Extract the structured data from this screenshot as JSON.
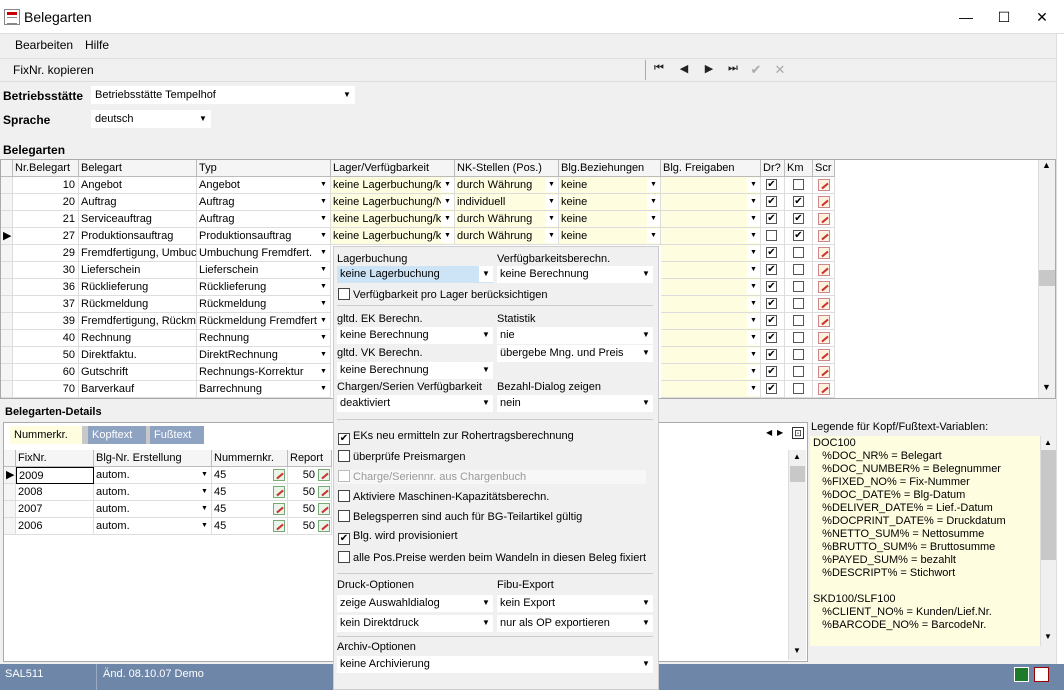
{
  "window": {
    "title": "Belegarten"
  },
  "menu": {
    "edit": "Bearbeiten",
    "help": "Hilfe"
  },
  "toolbar": {
    "copy_fixnr": "FixNr. kopieren"
  },
  "filters": {
    "betriebsstaette_label": "Betriebsstätte",
    "betriebsstaette_value": "Betriebsstätte Tempelhof",
    "sprache_label": "Sprache",
    "sprache_value": "deutsch"
  },
  "belegarten": {
    "section_title": "Belegarten",
    "columns": [
      "Nr.Belegart",
      "Belegart",
      "Typ",
      "Lager/Verfügbarkeit",
      "NK-Stellen (Pos.)",
      "Blg.Beziehungen",
      "Blg. Freigaben",
      "Dr?",
      "Km",
      "Scr"
    ],
    "rows": [
      {
        "nr": "10",
        "name": "Angebot",
        "typ": "Angebot",
        "lager": "keine Lagerbuchung/k",
        "nk": "durch Währung",
        "bez": "keine",
        "dr": true,
        "km": false
      },
      {
        "nr": "20",
        "name": "Auftrag",
        "typ": "Auftrag",
        "lager": "keine Lagerbuchung/N",
        "nk": "individuell",
        "bez": "keine",
        "dr": true,
        "km": true
      },
      {
        "nr": "21",
        "name": "Serviceauftrag",
        "typ": "Auftrag",
        "lager": "keine Lagerbuchung/k",
        "nk": "durch Währung",
        "bez": "keine",
        "dr": true,
        "km": true
      },
      {
        "nr": "27",
        "name": "Produktionsauftrag",
        "typ": "Produktionsauftrag",
        "lager": "keine Lagerbuchung/k",
        "nk": "durch Währung",
        "bez": "keine",
        "dr": false,
        "km": true
      },
      {
        "nr": "29",
        "name": "Fremdfertigung, Umbuch",
        "typ": "Umbuchung Fremdfert.",
        "dr": true,
        "km": false
      },
      {
        "nr": "30",
        "name": "Lieferschein",
        "typ": "Lieferschein",
        "dr": true,
        "km": false
      },
      {
        "nr": "36",
        "name": "Rücklieferung",
        "typ": "Rücklieferung",
        "dr": true,
        "km": false
      },
      {
        "nr": "37",
        "name": "Rückmeldung",
        "typ": "Rückmeldung",
        "dr": true,
        "km": false
      },
      {
        "nr": "39",
        "name": "Fremdfertigung, Rückme",
        "typ": "Rückmeldung Fremdfert",
        "dr": true,
        "km": false
      },
      {
        "nr": "40",
        "name": "Rechnung",
        "typ": "Rechnung",
        "dr": true,
        "km": false
      },
      {
        "nr": "50",
        "name": "Direktfaktu.",
        "typ": "DirektRechnung",
        "dr": true,
        "km": false
      },
      {
        "nr": "60",
        "name": "Gutschrift",
        "typ": "Rechnungs-Korrektur",
        "dr": true,
        "km": false
      },
      {
        "nr": "70",
        "name": "Barverkauf",
        "typ": "Barrechnung",
        "dr": true,
        "km": false
      }
    ]
  },
  "popup": {
    "lagerbuchung_label": "Lagerbuchung",
    "lagerbuchung_value": "keine Lagerbuchung",
    "verf_label": "Verfügbarkeitsberechn.",
    "verf_value": "keine Berechnung",
    "verf_pro_lager": "Verfügbarkeit pro Lager berücksichtigen",
    "ek_label": "gltd. EK Berechn.",
    "ek_value": "keine Berechnung",
    "statistik_label": "Statistik",
    "statistik_value": "nie",
    "vk_label": "gltd. VK Berechn.",
    "vk_value": "keine Berechnung",
    "uebergabe_value": "übergebe Mng. und Preis",
    "chargen_label": "Chargen/Serien Verfügbarkeit",
    "chargen_value": "deaktiviert",
    "bezahl_label": "Bezahl-Dialog zeigen",
    "bezahl_value": "nein",
    "checks": [
      {
        "label": "EKs neu ermitteln zur Rohertragsberechnung",
        "checked": true
      },
      {
        "label": "überprüfe Preismargen",
        "checked": false
      },
      {
        "label": "Charge/Seriennr. aus Chargenbuch",
        "checked": false
      },
      {
        "label": "Aktiviere Maschinen-Kapazitätsberechn.",
        "checked": false
      },
      {
        "label": "Belegsperren sind auch für BG-Teilartikel gültig",
        "checked": false
      },
      {
        "label": "Blg. wird provisioniert",
        "checked": true
      },
      {
        "label": "alle Pos.Preise werden beim Wandeln in diesen Beleg fixiert",
        "checked": false
      }
    ],
    "druck_label": "Druck-Optionen",
    "druck_value": "zeige Auswahldialog",
    "direktdruck_value": "kein Direktdruck",
    "fibu_label": "Fibu-Export",
    "fibu_value": "kein Export",
    "op_value": "nur als OP exportieren",
    "archiv_label": "Archiv-Optionen",
    "archiv_value": "keine Archivierung"
  },
  "details": {
    "section_title": "Belegarten-Details",
    "tabs": [
      "Nummerkr.",
      "Kopftext",
      "Fußtext"
    ],
    "columns": [
      "FixNr.",
      "Blg-Nr. Erstellung",
      "Nummernkr.",
      "Report"
    ],
    "rows": [
      {
        "fix": "2009",
        "erst": "autom.",
        "nk": "45",
        "rep": "50"
      },
      {
        "fix": "2008",
        "erst": "autom.",
        "nk": "45",
        "rep": "50"
      },
      {
        "fix": "2007",
        "erst": "autom.",
        "nk": "45",
        "rep": "50"
      },
      {
        "fix": "2006",
        "erst": "autom.",
        "nk": "45",
        "rep": "50"
      }
    ]
  },
  "legend": {
    "title": "Legende für Kopf/Fußtext-Variablen:",
    "lines": [
      "DOC100",
      "   %DOC_NR% = Belegart",
      "   %DOC_NUMBER% = Belegnummer",
      "   %FIXED_NO% = Fix-Nummer",
      "   %DOC_DATE% = Blg-Datum",
      "   %DELIVER_DATE% = Lief.-Datum",
      "   %DOCPRINT_DATE% = Druckdatum",
      "   %NETTO_SUM% = Nettosumme",
      "   %BRUTTO_SUM% = Bruttosumme",
      "   %PAYED_SUM% = bezahlt",
      "   %DESCRIPT% = Stichwort",
      "",
      "SKD100/SLF100",
      "   %CLIENT_NO% = Kunden/Lief.Nr.",
      "   %BARCODE_NO% = BarcodeNr."
    ]
  },
  "status": {
    "module": "SAL511",
    "changed": "Änd. 08.10.07 Demo"
  }
}
